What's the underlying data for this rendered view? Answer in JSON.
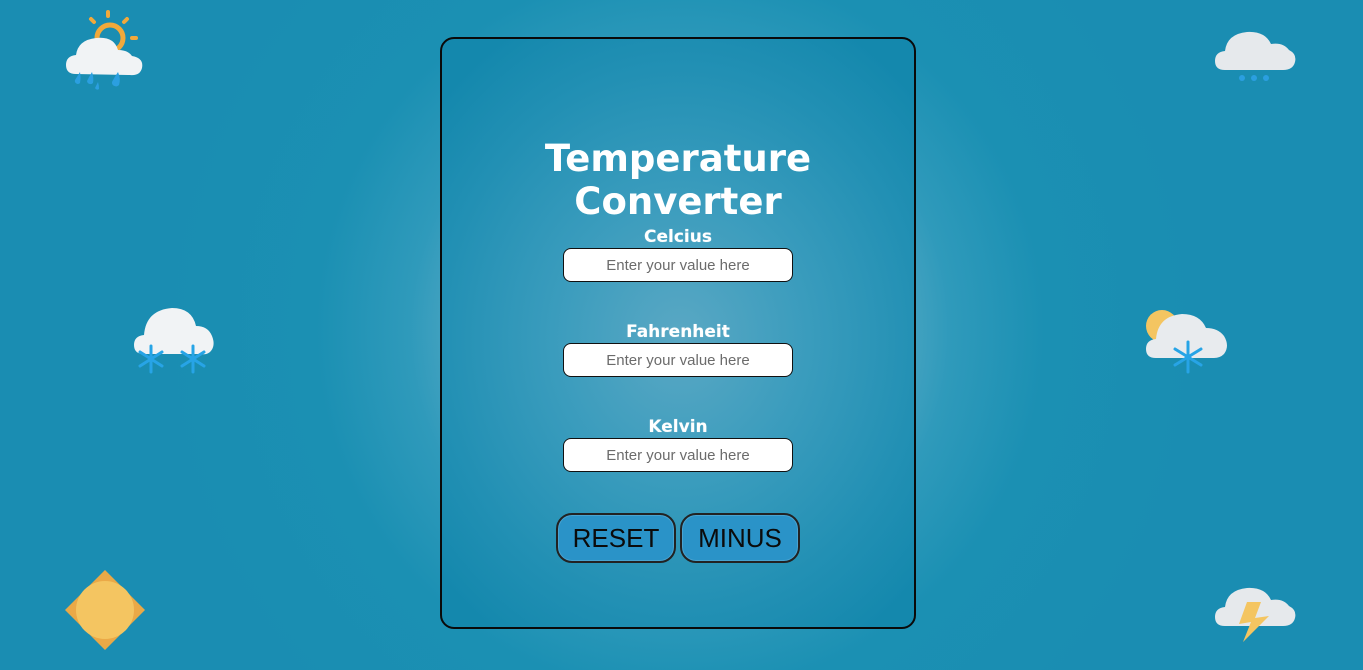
{
  "converter": {
    "title": "Temperature Converter",
    "fields": [
      {
        "label": "Celcius",
        "value": "",
        "placeholder": "Enter your value here"
      },
      {
        "label": "Fahrenheit",
        "value": "",
        "placeholder": "Enter your value here"
      },
      {
        "label": "Kelvin",
        "value": "",
        "placeholder": "Enter your value here"
      }
    ],
    "buttons": {
      "reset_label": "RESET",
      "minus_label": "MINUS"
    }
  },
  "background_icons": [
    {
      "name": "sun-cloud-rain-icon"
    },
    {
      "name": "rain-cloud-icon"
    },
    {
      "name": "snow-cloud-icon"
    },
    {
      "name": "sun-cloud-snow-icon"
    },
    {
      "name": "sun-icon"
    },
    {
      "name": "thunder-cloud-icon"
    }
  ],
  "colors": {
    "background": "#1a8db2",
    "card_center": "#5aa8c4",
    "button_fill": "#2a93c8",
    "sun_yellow": "#f4c561",
    "sun_orange": "#f2a93b",
    "cloud": "#f1f3f5",
    "rain_blue": "#2b9fe0",
    "snow_blue": "#27a4e6"
  }
}
